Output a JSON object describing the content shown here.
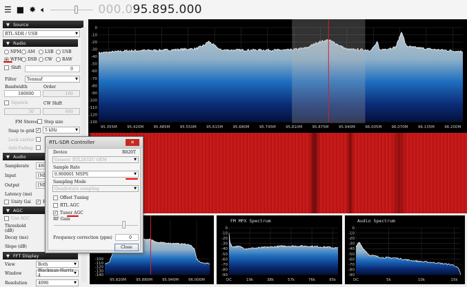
{
  "toolbar": {
    "icons": [
      "menu-icon",
      "stop-icon",
      "gear-icon",
      "speaker-icon"
    ],
    "frequency_dim": "000.0",
    "frequency_main": "95.895.000",
    "volume": 0.6
  },
  "source": {
    "header": "Source",
    "device": "RTL-SDR / USB"
  },
  "radio": {
    "header": "Radio",
    "modes": [
      "NFM",
      "AM",
      "LSB",
      "USB",
      "WFM",
      "DSB",
      "CW",
      "RAW"
    ],
    "selected_mode": "WFM",
    "shift_label": "Shift",
    "shift_value": "0",
    "filter_label": "Filter",
    "filter_value": "Tenmaf",
    "bandwidth_label": "Bandwidth",
    "bandwidth_value": "180000",
    "order_label": "Order",
    "order_value": "100",
    "squelch_label": "Squelch",
    "squelch_value": "50",
    "cw_shift_label": "CW Shift",
    "cw_shift_value": "600",
    "fm_stereo_label": "FM Stereo",
    "step_size_label": "Step size",
    "snap_label": "Snap to grid",
    "step_value": "5 kHz",
    "lock_carrier_label": "Lock carrier",
    "anti_fading_label": "Anti-Fading"
  },
  "audio": {
    "header": "Audio",
    "samplerate_label": "Samplerate",
    "samplerate_value": "48000",
    "input_label": "Input",
    "input_value": "[MME]",
    "output_label": "Output",
    "output_value": "[MME]",
    "latency_label": "Latency (ms)",
    "unity_gain_label": "Unity Gai",
    "filter_audio_label": "Fi"
  },
  "agc": {
    "header": "AGC",
    "use_agc_label": "Use AGC",
    "threshold_label": "Threshold (dB)",
    "decay_label": "Decay (ms)",
    "slope_label": "Slope (dB)"
  },
  "fft": {
    "header": "FFT Display",
    "view_label": "View",
    "view_value": "Both",
    "window_label": "Window",
    "window_value": "Blackman-Harris 4",
    "resolution_label": "Resolution",
    "resolution_value": "4096"
  },
  "dialog": {
    "title": "RTL-SDR Controller",
    "close_x": "✕",
    "device_label": "Device",
    "tuner": "R820T",
    "device_value": "Generic RTL2832U OEM",
    "sample_rate_label": "Sample Rate",
    "sample_rate_value": "0.900001 MSPS",
    "sampling_mode_label": "Sampling Mode",
    "sampling_mode_value": "Quadrature sampling",
    "offset_tuning_label": "Offset Tuning",
    "rtl_agc_label": "RTL AGC",
    "tuner_agc_label": "Tuner AGC",
    "tuner_agc_checked": true,
    "rf_gain_label": "RF Gain",
    "rf_gain": 0.85,
    "freq_corr_label": "Frequency correction (ppm)",
    "freq_corr_value": "0",
    "close_button": "Close"
  },
  "chart_data": [
    {
      "type": "area",
      "title": "",
      "name": "main-spectrum",
      "ylim": [
        -130,
        0
      ],
      "yticks": [
        0,
        -10,
        -20,
        -30,
        -40,
        -50,
        -60,
        -70,
        -80,
        -90,
        -100,
        -110,
        -120,
        -130
      ],
      "xlim": [
        95.33,
        96.225
      ],
      "xtick_values": [
        95.355,
        95.42,
        95.485,
        95.55,
        95.615,
        95.68,
        95.745,
        95.81,
        95.875,
        95.94,
        96.005,
        96.07,
        96.135,
        96.2
      ],
      "xtick_labels": [
        "95.355M",
        "95.420M",
        "95.485M",
        "95.550M",
        "95.615M",
        "95.680M",
        "95.745M",
        "95.810M",
        "95.875M",
        "95.940M",
        "96.005M",
        "96.070M",
        "96.135M",
        "96.200M"
      ],
      "trace_x": [
        95.33,
        95.4,
        95.5,
        95.57,
        95.59,
        95.6,
        95.61,
        95.63,
        95.7,
        95.8,
        95.84,
        95.87,
        95.895,
        95.91,
        95.94,
        96.0,
        96.015,
        96.02,
        96.03,
        96.06,
        96.075,
        96.085,
        96.1,
        96.15,
        96.225
      ],
      "trace_y": [
        -35,
        -32,
        -31,
        -29,
        -24,
        -19,
        -23,
        -31,
        -31,
        -31,
        -28,
        -20,
        -17,
        -21,
        -30,
        -31,
        -20,
        -31,
        -30,
        -27,
        -5,
        -25,
        -27,
        -30,
        -33
      ],
      "passband": [
        95.805,
        95.985
      ],
      "center": 95.895
    },
    {
      "type": "area",
      "name": "zoomed-spectrum",
      "ylim": [
        -140,
        0
      ],
      "yticks": [
        -100,
        -110,
        -120,
        -130,
        -140
      ],
      "xlim": [
        95.79,
        96.03
      ],
      "xtick_values": [
        95.82,
        95.88,
        95.94,
        96.0
      ],
      "xtick_labels": [
        "95.820M",
        "95.880M",
        "95.940M",
        "96.000M"
      ],
      "trace_x": [
        95.79,
        95.8,
        95.81,
        95.85,
        95.88,
        95.895,
        95.91,
        95.94,
        95.97,
        95.985,
        95.995,
        96.0,
        96.01,
        96.03
      ],
      "trace_y": [
        -112,
        -110,
        -78,
        -62,
        -50,
        -50,
        -58,
        -60,
        -62,
        -64,
        -75,
        -100,
        -110,
        -112
      ],
      "center": 95.895
    },
    {
      "type": "area",
      "title": "FM MPX Spectrum",
      "name": "fm-mpx-spectrum",
      "ylim": [
        -90,
        0
      ],
      "yticks": [
        0,
        -10,
        -20,
        -30,
        -40,
        -50,
        -60,
        -70,
        -80,
        -90
      ],
      "xlim": [
        0,
        100
      ],
      "xtick_values": [
        0,
        19,
        38,
        57,
        76,
        95
      ],
      "xtick_labels": [
        "DC",
        "19k",
        "38k",
        "57k",
        "76k",
        "95k"
      ],
      "trace_x": [
        0,
        1,
        3,
        10,
        15,
        30,
        50,
        70,
        90,
        100
      ],
      "trace_y": [
        -10,
        -30,
        -36,
        -36,
        -40,
        -38,
        -35,
        -35,
        -37,
        -39
      ]
    },
    {
      "type": "area",
      "title": "Audio Spectrum",
      "name": "audio-spectrum",
      "ylim": [
        -90,
        0
      ],
      "yticks": [
        0,
        -10,
        -20,
        -30,
        -40,
        -50,
        -60,
        -70,
        -80,
        -90
      ],
      "xlim": [
        0,
        16
      ],
      "xtick_values": [
        0,
        5,
        10,
        15
      ],
      "xtick_labels": [
        "DC",
        "5k",
        "10k",
        "15k"
      ],
      "trace_x": [
        0,
        0.5,
        1,
        1.5,
        2,
        4,
        6,
        8,
        10,
        12,
        14,
        15,
        15.6,
        16
      ],
      "trace_y": [
        -35,
        -28,
        -38,
        -45,
        -52,
        -57,
        -58,
        -62,
        -65,
        -67,
        -70,
        -72,
        -78,
        -90
      ]
    }
  ]
}
